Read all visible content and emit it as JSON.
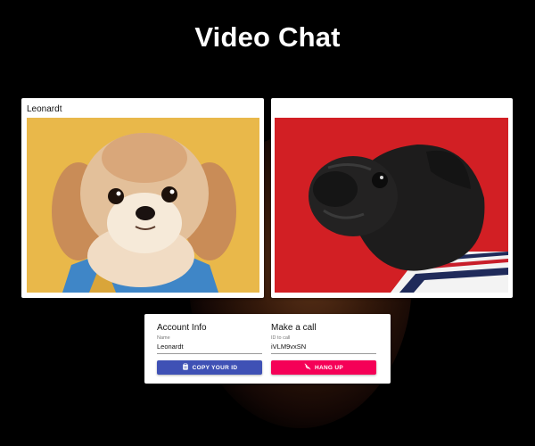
{
  "header": {
    "title": "Video Chat"
  },
  "videos": {
    "local": {
      "name": "Leonardt",
      "subject": "dog-photo-shihtzu"
    },
    "remote": {
      "name": "",
      "subject": "dog-photo-pug"
    }
  },
  "account": {
    "title": "Account Info",
    "name_label": "Name",
    "name_value": "Leonardt",
    "copy_button": "Copy Your ID",
    "copy_icon": "clipboard-icon"
  },
  "call": {
    "title": "Make a call",
    "id_label": "ID to call",
    "id_value": "iVLM9vxSN",
    "hangup_button": "Hang Up",
    "hangup_icon": "phone-off-icon"
  },
  "colors": {
    "background": "#000000",
    "primary": "#3f51b5",
    "secondary": "#f50057",
    "local_bg": "#e9b84a",
    "remote_bg": "#d21f24"
  }
}
